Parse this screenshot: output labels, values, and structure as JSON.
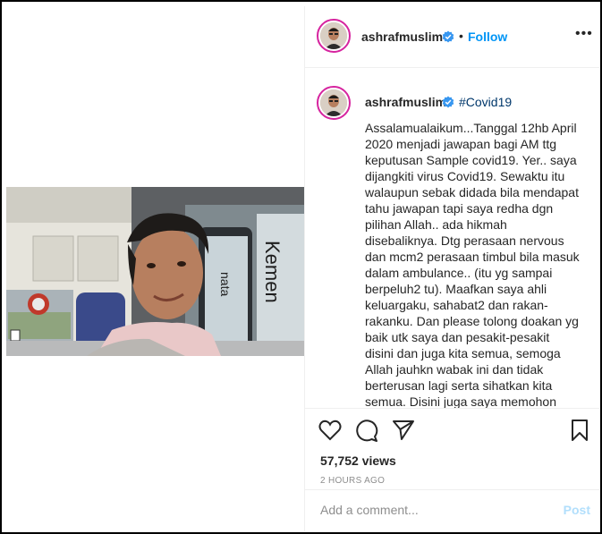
{
  "header": {
    "username": "ashrafmuslim",
    "separator": "•",
    "follow_label": "Follow",
    "more_label": "•••"
  },
  "caption": {
    "username": "ashrafmuslim",
    "hashtag": "#Covid19",
    "text": "Assalamualaikum...Tanggal 12hb April 2020 menjadi jawapan bagi AM ttg keputusan Sample covid19. Yer.. saya dijangkiti virus Covid19. Sewaktu itu walaupun sebak didada bila mendapat tahu jawapan tapi saya redha dgn pilihan Allah.. ada hikmah disebaliknya. Dtg perasaan nervous dan mcm2 perasaan timbul bila masuk dalam ambulance.. (itu yg sampai berpeluh2 tu). Maafkan saya ahli keluargaku, sahabat2 dan rakan-rakanku. Dan please tolong doakan yg baik utk saya dan pesakit-pesakit disini dan juga kita semua, semoga Allah jauhkn wabak ini dan tidak berterusan lagi serta sihatkan kita semua. Disini juga saya memohon"
  },
  "stats": {
    "views": "57,752 views",
    "time": "2 HOURS AGO"
  },
  "comment": {
    "placeholder": "Add a comment...",
    "post_label": "Post"
  },
  "colors": {
    "follow": "#0095f6",
    "post_disabled": "#b2dffc",
    "verified": "#3897f0"
  },
  "icons": [
    "heart-icon",
    "comment-icon",
    "share-icon",
    "bookmark-icon",
    "verified-badge-icon",
    "more-icon"
  ]
}
